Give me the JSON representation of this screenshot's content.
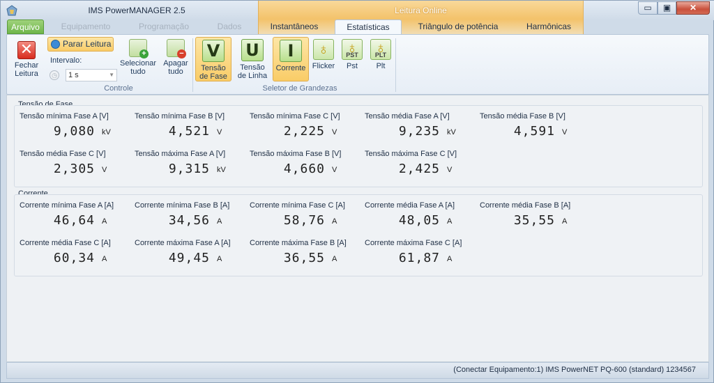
{
  "window": {
    "title": "IMS PowerMANAGER 2.5",
    "context_tab_label": "Leitura Online",
    "min_glyph": "▭",
    "max_glyph": "▣",
    "close_glyph": "✕"
  },
  "tabs": {
    "arquivo": "Arquivo",
    "equipamento": "Equipamento",
    "programacao": "Programação",
    "dados": "Dados",
    "instantaneos": "Instantâneos",
    "estatisticas": "Estatísticas",
    "triangulo": "Triângulo de potência",
    "harmonicas": "Harmônicas",
    "active": "Estatísticas"
  },
  "ribbon": {
    "fechar": {
      "line1": "Fechar",
      "line2": "Leitura",
      "icon": "close-x-icon"
    },
    "parar": "Parar Leitura",
    "intervalo_label": "Intervalo:",
    "intervalo_value": "1 s",
    "selecionar": {
      "line1": "Selecionar",
      "line2": "tudo"
    },
    "apagar": {
      "line1": "Apagar",
      "line2": "tudo"
    },
    "controle_label": "Controle",
    "tensao_fase": {
      "letter": "V",
      "line1": "Tensão",
      "line2": "de Fase"
    },
    "tensao_linha": {
      "letter": "U",
      "line1": "Tensão",
      "line2": "de Linha"
    },
    "corrente": {
      "letter": "I",
      "line1": "Corrente"
    },
    "flicker": {
      "line1": "Flicker"
    },
    "pst": {
      "line1": "Pst",
      "tag": "PST"
    },
    "plt": {
      "line1": "Plt",
      "tag": "PLT"
    },
    "seletor_label": "Seletor de Grandezas"
  },
  "tensao": {
    "title": "Tensão de Fase",
    "cells": [
      {
        "label": "Tensão mínima Fase A [V]",
        "value": "9,080",
        "unit": "kV"
      },
      {
        "label": "Tensão mínima Fase B [V]",
        "value": "4,521",
        "unit": "V"
      },
      {
        "label": "Tensão mínima Fase C [V]",
        "value": "2,225",
        "unit": "V"
      },
      {
        "label": "Tensão média Fase A [V]",
        "value": "9,235",
        "unit": "kV"
      },
      {
        "label": "Tensão média Fase B [V]",
        "value": "4,591",
        "unit": "V"
      },
      {
        "label": "Tensão média Fase C [V]",
        "value": "2,305",
        "unit": "V"
      },
      {
        "label": "Tensão máxima Fase A [V]",
        "value": "9,315",
        "unit": "kV"
      },
      {
        "label": "Tensão máxima Fase B [V]",
        "value": "4,660",
        "unit": "V"
      },
      {
        "label": "Tensão máxima Fase C [V]",
        "value": "2,425",
        "unit": "V"
      }
    ]
  },
  "corrente": {
    "title": "Corrente",
    "cells": [
      {
        "label": "Corrente mínima Fase A [A]",
        "value": "46,64",
        "unit": "A"
      },
      {
        "label": "Corrente mínima Fase B [A]",
        "value": "34,56",
        "unit": "A"
      },
      {
        "label": "Corrente mínima Fase C [A]",
        "value": "58,76",
        "unit": "A"
      },
      {
        "label": "Corrente média Fase A [A]",
        "value": "48,05",
        "unit": "A"
      },
      {
        "label": "Corrente média Fase B [A]",
        "value": "35,55",
        "unit": "A"
      },
      {
        "label": "Corrente média Fase C [A]",
        "value": "60,34",
        "unit": "A"
      },
      {
        "label": "Corrente máxima Fase A [A]",
        "value": "49,45",
        "unit": "A"
      },
      {
        "label": "Corrente máxima Fase B [A]",
        "value": "36,55",
        "unit": "A"
      },
      {
        "label": "Corrente máxima Fase C [A]",
        "value": "61,87",
        "unit": "A"
      }
    ]
  },
  "status": "(Conectar Equipamento:1) IMS PowerNET PQ-600 (standard) 1234567",
  "colors": {
    "accent_orange": "#f3c26a",
    "accent_green": "#6fb64a",
    "close_red": "#c9503c"
  }
}
